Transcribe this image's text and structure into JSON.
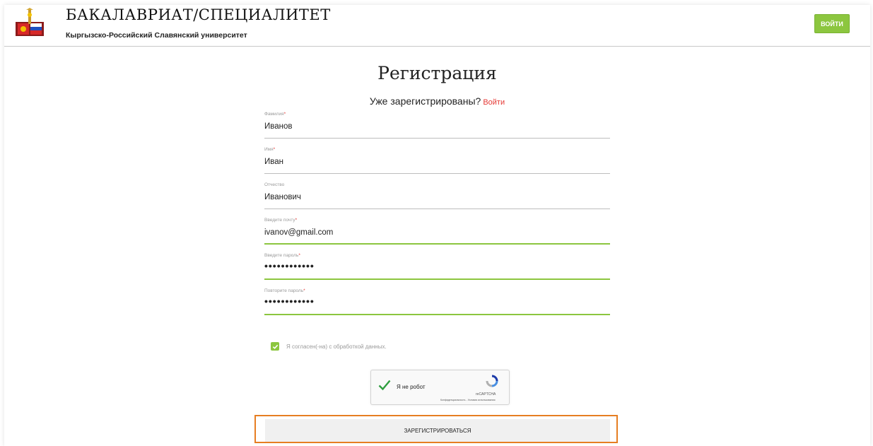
{
  "header": {
    "title": "БАКАЛАВРИАТ/СПЕЦИАЛИТЕТ",
    "subtitle": "Кыргызско-Российский Славянский университет",
    "login_button": "войти"
  },
  "form": {
    "title": "Регистрация",
    "already_registered": "Уже зарегистрированы?",
    "login_link": "Войти",
    "fields": [
      {
        "label": "Фамилия",
        "required": "*",
        "value": "Иванов",
        "state": "default"
      },
      {
        "label": "Имя",
        "required": "*",
        "value": "Иван",
        "state": "default"
      },
      {
        "label": "Отчество",
        "required": "",
        "value": "Иванович",
        "state": "default"
      },
      {
        "label": "Введите почту",
        "required": "*",
        "value": "ivanov@gmail.com",
        "state": "valid"
      },
      {
        "label": "Введите пароль",
        "required": "*",
        "value": "••••••••••••",
        "state": "valid"
      },
      {
        "label": "Повторите пароль",
        "required": "*",
        "value": "••••••••••••",
        "state": "valid"
      }
    ],
    "consent": {
      "checked": true,
      "label": "Я согласен(-на) с обработкой данных."
    },
    "captcha": {
      "checked": true,
      "label": "Я не робот",
      "brand": "reCAPTCHA",
      "links": "Конфиденциальность - Условия использования"
    },
    "submit_label": "ЗАРЕГИСТРИРОВАТЬСЯ"
  },
  "colors": {
    "accent_green": "#8cc63f",
    "link_red": "#e53935",
    "highlight_orange": "#e67e22"
  }
}
